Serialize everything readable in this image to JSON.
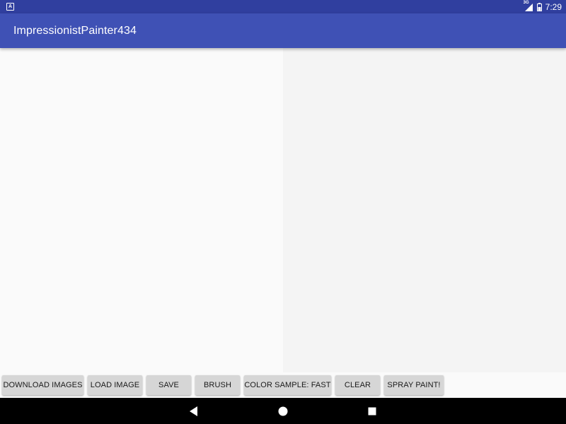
{
  "status_bar": {
    "notification_icon_letter": "A",
    "network_label": "3G",
    "time": "7:29",
    "icons": [
      "notification-icon",
      "signal-icon",
      "battery-icon"
    ]
  },
  "app_bar": {
    "title": "ImpressionistPainter434"
  },
  "buttons": {
    "download_images": "DOWNLOAD IMAGES",
    "load_image": "LOAD IMAGE",
    "save": "SAVE",
    "brush": "BRUSH",
    "color_sample": "COLOR SAMPLE: FAST",
    "clear": "CLEAR",
    "spray_paint": "SPRAY PAINT!"
  },
  "nav_bar": {
    "icons": [
      "back-icon",
      "home-icon",
      "recents-icon"
    ]
  },
  "colors": {
    "status_bar": "#303f9f",
    "app_bar": "#3f51b5",
    "button": "#d6d6d6",
    "nav_bar": "#000000"
  }
}
